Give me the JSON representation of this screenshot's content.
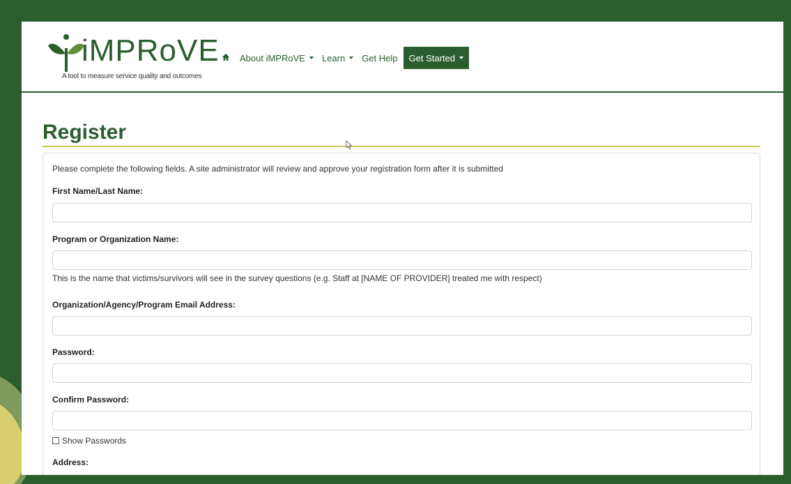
{
  "brand": {
    "name": "iMPRoVE",
    "tagline": "A tool to measure service quality and outcomes",
    "color": "#2b5e2e"
  },
  "nav": {
    "home_icon": "home-icon",
    "about": "About iMPRoVE",
    "learn": "Learn",
    "help": "Get Help",
    "cta": "Get Started"
  },
  "page": {
    "title": "Register",
    "intro": "Please complete the following fields. A site administrator will review and approve your registration form after it is submitted"
  },
  "form": {
    "name_label": "First Name/Last Name:",
    "org_label": "Program or Organization Name:",
    "org_help": "This is the name that victims/survivors will see in the survey questions (e.g. Staff at [NAME OF PROVIDER] treated me with respect)",
    "email_label": "Organization/Agency/Program Email Address:",
    "password_label": "Password:",
    "confirm_label": "Confirm Password:",
    "show_passwords": "Show Passwords",
    "address_label": "Address:"
  }
}
